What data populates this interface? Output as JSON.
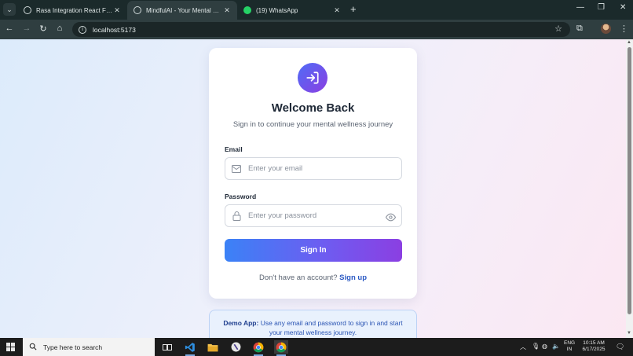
{
  "browser": {
    "tabs": [
      {
        "title": "Rasa Integration React Flask",
        "active": false
      },
      {
        "title": "MindfulAI - Your Mental Health Companion",
        "active": true
      },
      {
        "title": "(19) WhatsApp",
        "active": false
      }
    ],
    "new_tab": "+",
    "url": "localhost:5173"
  },
  "login": {
    "heading": "Welcome Back",
    "subheading": "Sign in to continue your mental wellness journey",
    "email_label": "Email",
    "email_placeholder": "Enter your email",
    "password_label": "Password",
    "password_placeholder": "Enter your password",
    "submit_label": "Sign In",
    "signup_prompt": "Don't have an account?",
    "signup_link": "Sign up"
  },
  "demo": {
    "label": "Demo App:",
    "text": "Use any email and password to sign in and start your mental wellness journey."
  },
  "taskbar": {
    "search_placeholder": "Type here to search",
    "lang_line1": "ENG",
    "lang_line2": "IN",
    "time": "10:15 AM",
    "date": "6/17/2025"
  },
  "colors": {
    "accent_start": "#3b82f6",
    "accent_end": "#8b3fe2",
    "link": "#2b59c3"
  },
  "icons": [
    "search-icon",
    "mail-icon",
    "lock-icon",
    "eye-icon",
    "login-icon",
    "home-icon",
    "star-icon"
  ]
}
